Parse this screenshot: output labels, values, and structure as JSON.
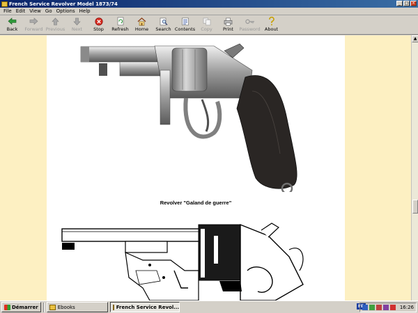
{
  "window": {
    "title": "French Service Revolver Model 1873/74"
  },
  "menu": {
    "items": [
      "File",
      "Edit",
      "View",
      "Go",
      "Options",
      "Help"
    ]
  },
  "toolbar": {
    "buttons": [
      {
        "label": "Back",
        "icon": "back-arrow-icon",
        "enabled": true
      },
      {
        "label": "Forward",
        "icon": "forward-arrow-icon",
        "enabled": false
      },
      {
        "label": "Previous",
        "icon": "up-arrow-icon",
        "enabled": false
      },
      {
        "label": "Next",
        "icon": "down-arrow-icon",
        "enabled": false
      },
      {
        "label": "Stop",
        "icon": "stop-icon",
        "enabled": true
      },
      {
        "label": "Refresh",
        "icon": "refresh-icon",
        "enabled": true
      },
      {
        "label": "Home",
        "icon": "home-icon",
        "enabled": true
      },
      {
        "label": "Search",
        "icon": "search-icon",
        "enabled": true
      },
      {
        "label": "Contents",
        "icon": "contents-icon",
        "enabled": true
      },
      {
        "label": "Copy",
        "icon": "copy-icon",
        "enabled": false
      },
      {
        "label": "Print",
        "icon": "print-icon",
        "enabled": true
      },
      {
        "label": "Password",
        "icon": "key-icon",
        "enabled": false
      },
      {
        "label": "About",
        "icon": "question-icon",
        "enabled": true
      }
    ]
  },
  "page": {
    "caption": "Revolver \"Galand de guerre\""
  },
  "taskbar": {
    "start_label": "Démarrer",
    "tasks": [
      {
        "label": "Ebooks",
        "active": false
      },
      {
        "label": "French Service Revol...",
        "active": true
      }
    ],
    "language": "FR",
    "clock": "16:26"
  },
  "colors": {
    "titlebar": "#0a246a",
    "content_bg": "#fdf0c2",
    "page_bg": "#ffffff",
    "chrome": "#d4d0c8"
  }
}
